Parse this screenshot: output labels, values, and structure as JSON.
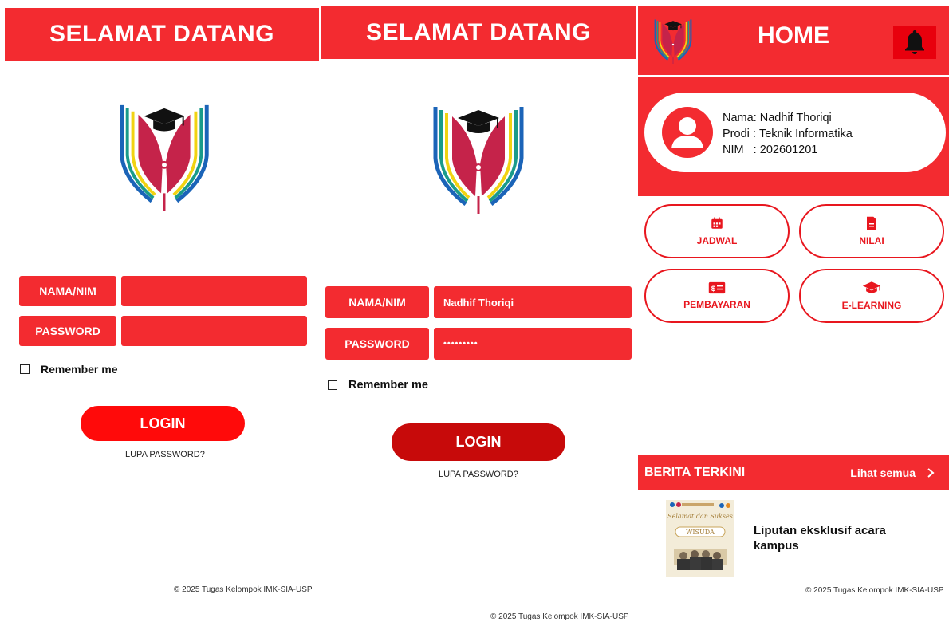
{
  "colors": {
    "primary": "#f32b30",
    "button_red": "#ff0a0a",
    "button_dark_red": "#c70a0a",
    "white": "#ffffff"
  },
  "login_empty": {
    "header_title": "SELAMAT DATANG",
    "logo_icon": "graduation-book-logo",
    "username_label": "NAMA/NIM",
    "username_value": "",
    "password_label": "PASSWORD",
    "password_value": "",
    "remember_label": "Remember me",
    "remember_checked": false,
    "login_label": "LOGIN",
    "forgot_label": "LUPA PASSWORD?",
    "footer": "© 2025 Tugas Kelompok IMK-SIA-USP"
  },
  "login_filled": {
    "header_title": "SELAMAT DATANG",
    "logo_icon": "graduation-book-logo",
    "username_label": "NAMA/NIM",
    "username_value": "Nadhif Thoriqi",
    "password_label": "PASSWORD",
    "password_value": "•••••••••",
    "remember_label": "Remember me",
    "remember_checked": false,
    "login_label": "LOGIN",
    "forgot_label": "LUPA PASSWORD?",
    "footer": "© 2025 Tugas Kelompok IMK-SIA-USP"
  },
  "home": {
    "header_title": "HOME",
    "logo_icon": "graduation-book-logo",
    "bell_icon": "bell-icon",
    "profile": {
      "avatar_icon": "user-avatar-icon",
      "rows": [
        {
          "key": "Nama",
          "sep": ": ",
          "value": "Nadhif Thoriqi"
        },
        {
          "key": "Prodi",
          "sep": " : ",
          "value": "Teknik Informatika"
        },
        {
          "key": "NIM",
          "sep": "   : ",
          "value": "202601201"
        }
      ]
    },
    "menu": [
      {
        "label": "JADWAL",
        "icon": "calendar-icon"
      },
      {
        "label": "NILAI",
        "icon": "document-icon"
      },
      {
        "label": "PEMBAYARAN",
        "icon": "money-icon"
      },
      {
        "label": "E-LEARNING",
        "icon": "graduation-cap-icon"
      }
    ],
    "news_title": "BERITA TERKINI",
    "see_all": "Lihat semua",
    "news_items": [
      {
        "thumb_icon": "wisuda-poster-thumbnail",
        "thumb_heading": "Selamat dan Sukses",
        "thumb_title": "WISUDA",
        "text_line1": "Liputan eksklusif acara",
        "text_line2": "kampus"
      }
    ],
    "footer": "© 2025 Tugas Kelompok IMK-SIA-USP"
  },
  "page_footer": "© 2025 Tugas Kelompok IMK-SIA-USP"
}
